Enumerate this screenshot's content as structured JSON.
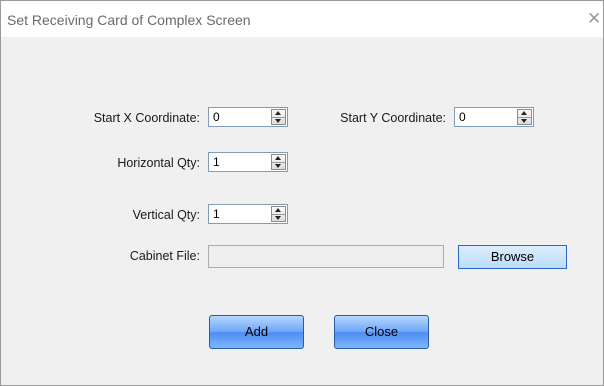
{
  "dialog": {
    "title": "Set Receiving Card of Complex Screen",
    "close_glyph": "✕"
  },
  "form": {
    "start_x": {
      "label": "Start X Coordinate:",
      "value": "0"
    },
    "start_y": {
      "label": "Start Y Coordinate:",
      "value": "0"
    },
    "horizontal_qty": {
      "label": "Horizontal Qty:",
      "value": "1"
    },
    "vertical_qty": {
      "label": "Vertical Qty:",
      "value": "1"
    },
    "cabinet_file": {
      "label": "Cabinet File:",
      "value": ""
    }
  },
  "buttons": {
    "browse": "Browse",
    "add": "Add",
    "close": "Close"
  },
  "icons": {
    "spin_up": "triangle-up-icon",
    "spin_down": "triangle-down-icon",
    "close": "close-icon"
  },
  "colors": {
    "accent": "#4f8ef2",
    "browse_border": "#2a68c8",
    "window_bg": "#f0f0f0"
  }
}
